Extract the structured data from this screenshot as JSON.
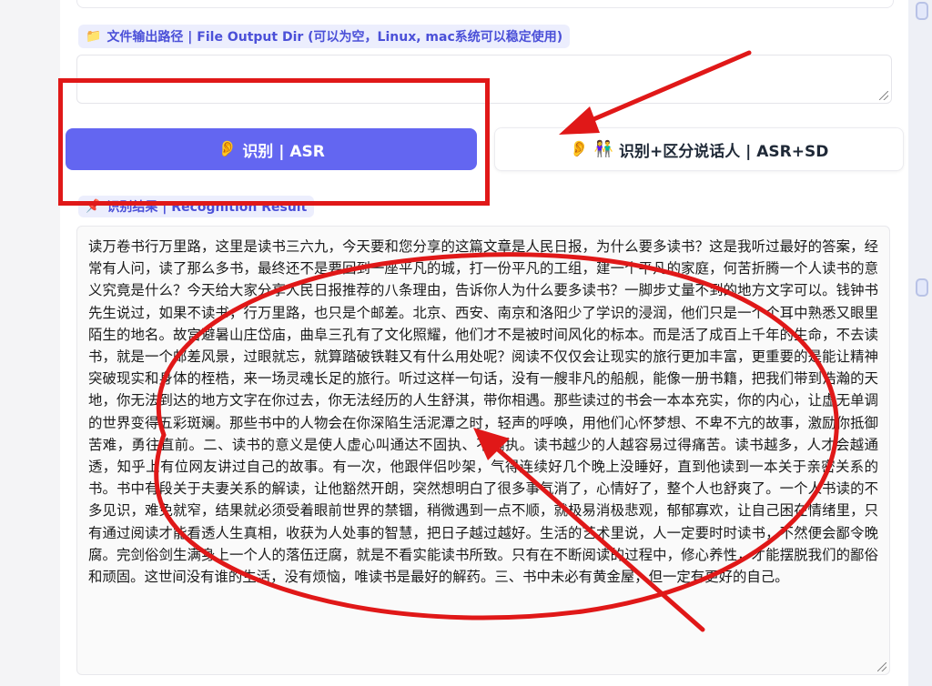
{
  "file_output": {
    "icon": "folder-icon",
    "label": "文件输出路径 | File Output Dir (可以为空，Linux, mac系统可以稳定使用)",
    "value": ""
  },
  "buttons": {
    "asr": {
      "icon": "ear-icon",
      "label": "识别 | ASR"
    },
    "asr_sd": {
      "icons": [
        "ear-icon",
        "people-icon"
      ],
      "label": "识别+区分说话人 | ASR+SD"
    }
  },
  "result": {
    "icon": "pushpin-icon",
    "label": "识别结果 | Recognition Result",
    "text": "读万卷书行万里路，这里是读书三六九，今天要和您分享的这篇文章是人民日报，为什么要多读书？这是我听过最好的答案，经常有人问，读了那么多书，最终还不是要回到一座平凡的城，打一份平凡的工组，建一个平凡的家庭，何苦折腾一个人读书的意义究竟是什么？今天给大家分享人民日报推荐的八条理由，告诉你人为什么要多读书？一脚步丈量不到的地方文字可以。钱钟书先生说过，如果不读书，行万里路，也只是个邮差。北京、西安、南京和洛阳少了学识的浸润，他们只是一个个耳中熟悉又眼里陌生的地名。故宫避暑山庄岱庙，曲阜三孔有了文化照耀，他们才不是被时间风化的标本。而是活了成百上千年的生命，不去读书，就是一个邮差风景，过眼就忘，就算踏破铁鞋又有什么用处呢？阅读不仅仅会让现实的旅行更加丰富，更重要的是能让精神突破现实和身体的桎梏，来一场灵魂长足的旅行。听过这样一句话，没有一艘非凡的船舰，能像一册书籍，把我们带到浩瀚的天地，你无法到达的地方文字在你过去，你无法经历的人生舒淇，带你相遇。那些读过的书会一本本充实，你的内心，让虚无单调的世界变得五彩斑斓。那些书中的人物会在你深陷生活泥潭之时，轻声的呼唤，用他们心怀梦想、不卑不亢的故事，激励你抵御苦难，勇往直前。二、读书的意义是使人虚心叫通达不固执、不偏执。读书越少的人越容易过得痛苦。读书越多，人才会越通透，知乎上有位网友讲过自己的故事。有一次，他跟伴侣吵架，气得连续好几个晚上没睡好，直到他读到一本关于亲密关系的书。书中有段关于夫妻关系的解读，让他豁然开朗，突然想明白了很多事气消了，心情好了，整个人也舒爽了。一个人书读的不多见识，难免就窄，结果就必须受着眼前世界的禁锢，稍微遇到一点不顺，就极易消极悲观，郁郁寡欢，让自己困在情绪里，只有通过阅读才能看透人生真相，收获为人处事的智慧，把日子越过越好。生活的艺术里说，人一定要时时读书，不然便会鄙令晚腐。完剑俗剑生满身上一个人的落伍迂腐，就是不看实能读书所致。只有在不断阅读的过程中，修心养性，才能摆脱我们的鄙俗和顽固。这世间没有谁的生活，没有烦恼，唯读书是最好的解药。三、书中未必有黄金屋，但一定有更好的自己。"
  },
  "annotation_color": "#e01818",
  "accent_color": "#6366f1"
}
